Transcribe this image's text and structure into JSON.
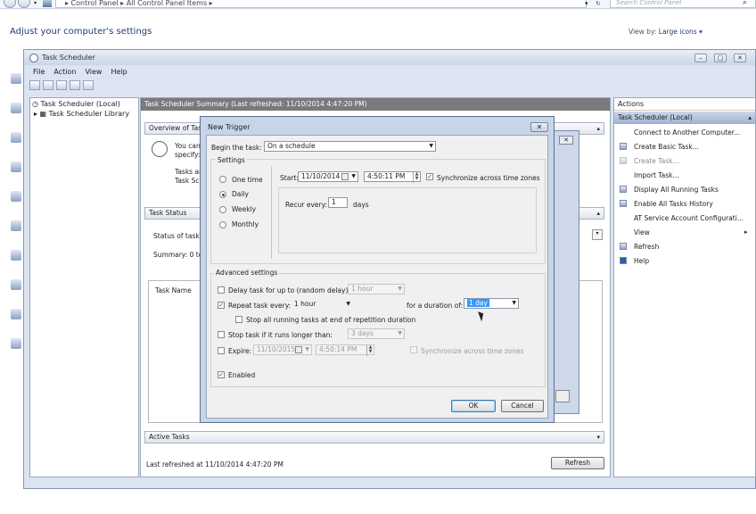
{
  "explorer": {
    "breadcrumb": "▸  Control Panel  ▸  All Control Panel Items  ▸",
    "search_placeholder": "Search Control Panel",
    "heading": "Adjust your computer's settings",
    "view_by_label": "View by:",
    "view_by_value": "Large icons ▾"
  },
  "window": {
    "title": "Task Scheduler",
    "menu": [
      "File",
      "Action",
      "View",
      "Help"
    ]
  },
  "tree": {
    "root": "Task Scheduler (Local)",
    "child": "Task Scheduler Library"
  },
  "summary": {
    "header": "Task Scheduler Summary (Last refreshed: 11/10/2014 4:47:20 PM)",
    "overview_label": "Overview of Task",
    "overview_text1": "You can",
    "overview_text2": "specify:",
    "overview_text3": "Tasks ar",
    "overview_text4": "Task Sc",
    "task_status_label": "Task Status",
    "status_of_tasks": "Status of tasks",
    "summary_line": "Summary: 0 to",
    "task_name_col": "Task Name",
    "active_tasks_label": "Active Tasks",
    "last_refreshed": "Last refreshed at 11/10/2014 4:47:20 PM",
    "refresh_button": "Refresh"
  },
  "actions": {
    "header": "Actions",
    "subheader": "Task Scheduler (Local)",
    "items": [
      "Connect to Another Computer...",
      "Create Basic Task...",
      "Create Task...",
      "Import Task...",
      "Display All Running Tasks",
      "Enable All Tasks History",
      "AT Service Account Configurati...",
      "View",
      "Refresh",
      "Help"
    ]
  },
  "dialog": {
    "title": "New Trigger",
    "begin_task_label": "Begin the task:",
    "begin_task_value": "On a schedule",
    "settings_label": "Settings",
    "radios": [
      "One time",
      "Daily",
      "Weekly",
      "Monthly"
    ],
    "selected_radio": "Daily",
    "start_label": "Start:",
    "start_date": "11/10/2014",
    "start_time": "4:50:11 PM",
    "sync_label": "Synchronize across time zones",
    "recur_label": "Recur every:",
    "recur_value": "1",
    "recur_unit": "days",
    "advanced_label": "Advanced settings",
    "delay_label": "Delay task for up to (random delay):",
    "delay_value": "1 hour",
    "repeat_label": "Repeat task every:",
    "repeat_value": "1 hour",
    "duration_label": "for a duration of:",
    "duration_value": "1 day",
    "stop_all_label": "Stop all running tasks at end of repetition duration",
    "stop_longer_label": "Stop task if it runs longer than:",
    "stop_longer_value": "3 days",
    "expire_label": "Expire:",
    "expire_date": "11/10/2015",
    "expire_time": "4:50:14 PM",
    "expire_sync_label": "Synchronize across time zones",
    "enabled_label": "Enabled",
    "ok": "OK",
    "cancel": "Cancel"
  }
}
